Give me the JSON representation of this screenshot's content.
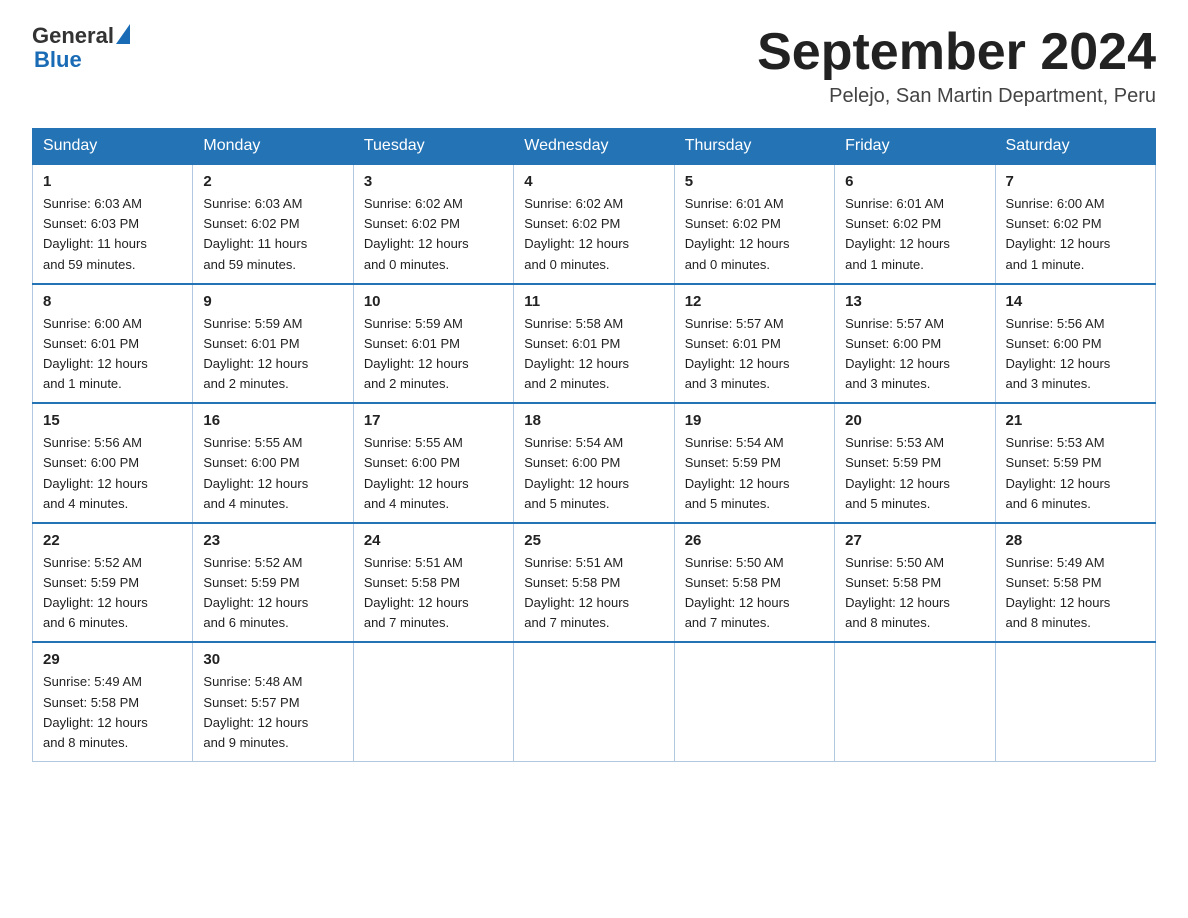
{
  "header": {
    "logo_text_general": "General",
    "logo_text_blue": "Blue",
    "month_title": "September 2024",
    "location": "Pelejo, San Martin Department, Peru"
  },
  "days_of_week": [
    "Sunday",
    "Monday",
    "Tuesday",
    "Wednesday",
    "Thursday",
    "Friday",
    "Saturday"
  ],
  "weeks": [
    [
      {
        "day": "1",
        "sunrise": "6:03 AM",
        "sunset": "6:03 PM",
        "daylight": "11 hours and 59 minutes."
      },
      {
        "day": "2",
        "sunrise": "6:03 AM",
        "sunset": "6:02 PM",
        "daylight": "11 hours and 59 minutes."
      },
      {
        "day": "3",
        "sunrise": "6:02 AM",
        "sunset": "6:02 PM",
        "daylight": "12 hours and 0 minutes."
      },
      {
        "day": "4",
        "sunrise": "6:02 AM",
        "sunset": "6:02 PM",
        "daylight": "12 hours and 0 minutes."
      },
      {
        "day": "5",
        "sunrise": "6:01 AM",
        "sunset": "6:02 PM",
        "daylight": "12 hours and 0 minutes."
      },
      {
        "day": "6",
        "sunrise": "6:01 AM",
        "sunset": "6:02 PM",
        "daylight": "12 hours and 1 minute."
      },
      {
        "day": "7",
        "sunrise": "6:00 AM",
        "sunset": "6:02 PM",
        "daylight": "12 hours and 1 minute."
      }
    ],
    [
      {
        "day": "8",
        "sunrise": "6:00 AM",
        "sunset": "6:01 PM",
        "daylight": "12 hours and 1 minute."
      },
      {
        "day": "9",
        "sunrise": "5:59 AM",
        "sunset": "6:01 PM",
        "daylight": "12 hours and 2 minutes."
      },
      {
        "day": "10",
        "sunrise": "5:59 AM",
        "sunset": "6:01 PM",
        "daylight": "12 hours and 2 minutes."
      },
      {
        "day": "11",
        "sunrise": "5:58 AM",
        "sunset": "6:01 PM",
        "daylight": "12 hours and 2 minutes."
      },
      {
        "day": "12",
        "sunrise": "5:57 AM",
        "sunset": "6:01 PM",
        "daylight": "12 hours and 3 minutes."
      },
      {
        "day": "13",
        "sunrise": "5:57 AM",
        "sunset": "6:00 PM",
        "daylight": "12 hours and 3 minutes."
      },
      {
        "day": "14",
        "sunrise": "5:56 AM",
        "sunset": "6:00 PM",
        "daylight": "12 hours and 3 minutes."
      }
    ],
    [
      {
        "day": "15",
        "sunrise": "5:56 AM",
        "sunset": "6:00 PM",
        "daylight": "12 hours and 4 minutes."
      },
      {
        "day": "16",
        "sunrise": "5:55 AM",
        "sunset": "6:00 PM",
        "daylight": "12 hours and 4 minutes."
      },
      {
        "day": "17",
        "sunrise": "5:55 AM",
        "sunset": "6:00 PM",
        "daylight": "12 hours and 4 minutes."
      },
      {
        "day": "18",
        "sunrise": "5:54 AM",
        "sunset": "6:00 PM",
        "daylight": "12 hours and 5 minutes."
      },
      {
        "day": "19",
        "sunrise": "5:54 AM",
        "sunset": "5:59 PM",
        "daylight": "12 hours and 5 minutes."
      },
      {
        "day": "20",
        "sunrise": "5:53 AM",
        "sunset": "5:59 PM",
        "daylight": "12 hours and 5 minutes."
      },
      {
        "day": "21",
        "sunrise": "5:53 AM",
        "sunset": "5:59 PM",
        "daylight": "12 hours and 6 minutes."
      }
    ],
    [
      {
        "day": "22",
        "sunrise": "5:52 AM",
        "sunset": "5:59 PM",
        "daylight": "12 hours and 6 minutes."
      },
      {
        "day": "23",
        "sunrise": "5:52 AM",
        "sunset": "5:59 PM",
        "daylight": "12 hours and 6 minutes."
      },
      {
        "day": "24",
        "sunrise": "5:51 AM",
        "sunset": "5:58 PM",
        "daylight": "12 hours and 7 minutes."
      },
      {
        "day": "25",
        "sunrise": "5:51 AM",
        "sunset": "5:58 PM",
        "daylight": "12 hours and 7 minutes."
      },
      {
        "day": "26",
        "sunrise": "5:50 AM",
        "sunset": "5:58 PM",
        "daylight": "12 hours and 7 minutes."
      },
      {
        "day": "27",
        "sunrise": "5:50 AM",
        "sunset": "5:58 PM",
        "daylight": "12 hours and 8 minutes."
      },
      {
        "day": "28",
        "sunrise": "5:49 AM",
        "sunset": "5:58 PM",
        "daylight": "12 hours and 8 minutes."
      }
    ],
    [
      {
        "day": "29",
        "sunrise": "5:49 AM",
        "sunset": "5:58 PM",
        "daylight": "12 hours and 8 minutes."
      },
      {
        "day": "30",
        "sunrise": "5:48 AM",
        "sunset": "5:57 PM",
        "daylight": "12 hours and 9 minutes."
      },
      null,
      null,
      null,
      null,
      null
    ]
  ],
  "labels": {
    "sunrise": "Sunrise:",
    "sunset": "Sunset:",
    "daylight": "Daylight:"
  }
}
